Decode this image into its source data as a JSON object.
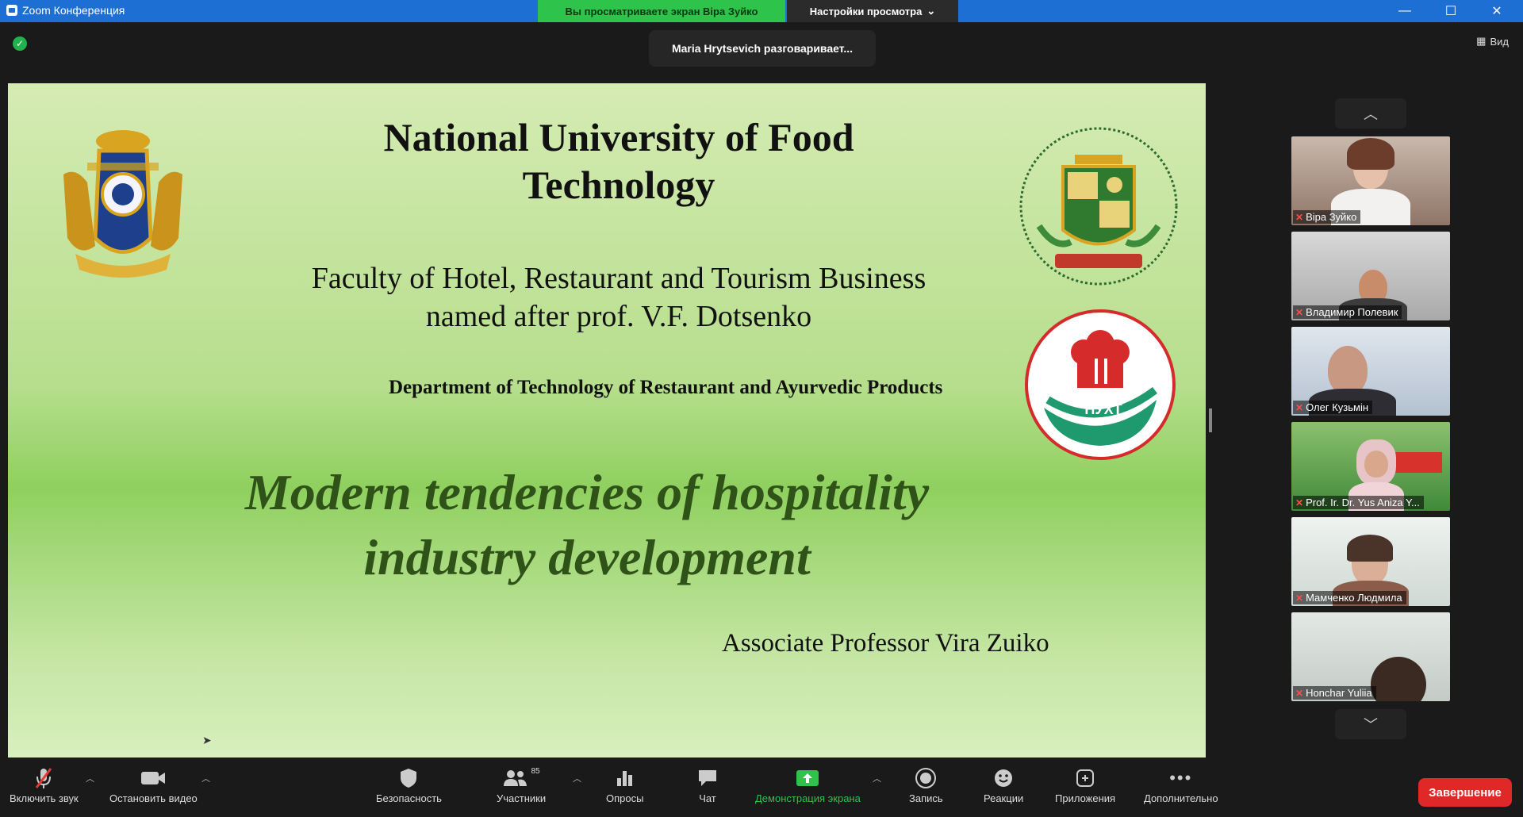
{
  "window": {
    "title": "Zoom Конференция",
    "share_banner": "Вы просматриваете экран Віра Зуйко",
    "view_options": "Настройки просмотра",
    "controls": [
      "—",
      "☐",
      "✕"
    ]
  },
  "meeting": {
    "speaking_notice": "Maria Hrytsevich разговаривает...",
    "view_button": "Вид"
  },
  "slide": {
    "title": "National University of Food Technology",
    "faculty_line1": "Faculty of Hotel, Restaurant and Tourism Business",
    "faculty_line2": "named after prof. V.F. Dotsenko",
    "department": "Department of Technology of Restaurant and Ayurvedic Products",
    "topic_line1": "Modern tendencies of hospitality",
    "topic_line2": "industry development",
    "author": "Associate Professor Vira Zuiko",
    "logo_text": "НУХТ"
  },
  "participants": [
    {
      "name": "Віра Зуйко"
    },
    {
      "name": "Владимир Полевик"
    },
    {
      "name": "Олег Кузьмін"
    },
    {
      "name": "Prof. Ir. Dr. Yus Aniza Y..."
    },
    {
      "name": "Мамченко Людмила"
    },
    {
      "name": "Honchar Yuliia"
    }
  ],
  "toolbar": {
    "unmute": "Включить звук",
    "stop_video": "Остановить видео",
    "security": "Безопасность",
    "participants": "Участники",
    "participants_count": "85",
    "polls": "Опросы",
    "chat": "Чат",
    "share_screen": "Демонстрация экрана",
    "record": "Запись",
    "reactions": "Реакции",
    "apps": "Приложения",
    "more": "Дополнительно",
    "end": "Завершение"
  },
  "colors": {
    "titlebar": "#1d6fd3",
    "share_banner": "#2ec34a",
    "end_button": "#e02828",
    "topic_text": "#2f5219"
  }
}
